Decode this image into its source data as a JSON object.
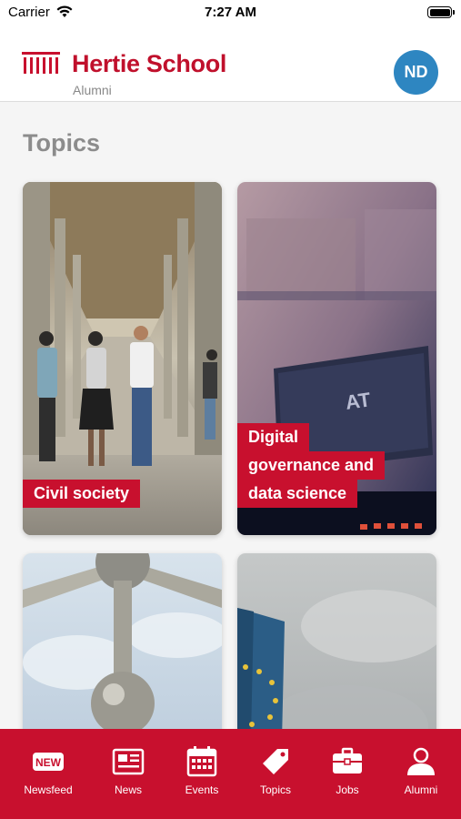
{
  "status_bar": {
    "carrier": "Carrier",
    "time": "7:27 AM"
  },
  "header": {
    "brand_name": "Hertie School",
    "brand_sub": "Alumni",
    "avatar_initials": "ND"
  },
  "main": {
    "section_title": "Topics",
    "topics": [
      {
        "label_lines": [
          "Civil society"
        ]
      },
      {
        "label_lines": [
          "Digital",
          "governance and",
          "data science"
        ]
      },
      {
        "label_lines": []
      },
      {
        "label_lines": []
      }
    ]
  },
  "tab_bar": {
    "tabs": [
      {
        "label": "Newsfeed",
        "icon": "new-badge-icon",
        "icon_text": "NEW"
      },
      {
        "label": "News",
        "icon": "newspaper-icon"
      },
      {
        "label": "Events",
        "icon": "calendar-icon"
      },
      {
        "label": "Topics",
        "icon": "tag-icon"
      },
      {
        "label": "Jobs",
        "icon": "briefcase-icon"
      },
      {
        "label": "Alumni",
        "icon": "person-icon"
      }
    ]
  },
  "colors": {
    "brand_red": "#c8102e",
    "avatar_blue": "#2e86c1",
    "title_gray": "#8c8c8c"
  }
}
